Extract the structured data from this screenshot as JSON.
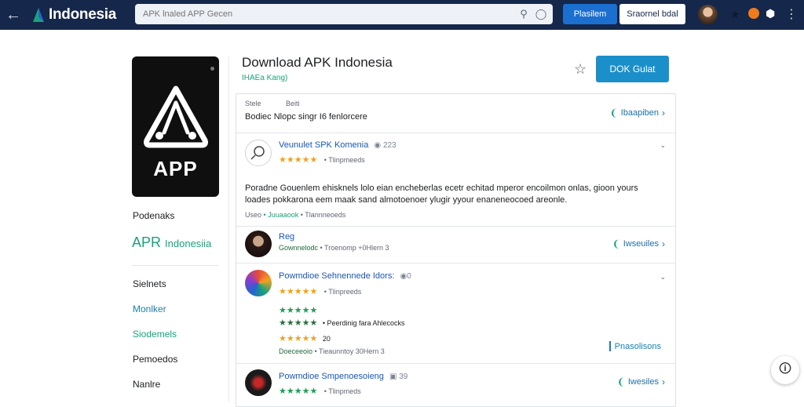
{
  "topbar": {
    "logo_text": "Indonesia",
    "search_placeholder": "APK lnaled APP Gecen",
    "primary_btn": "Plasilem",
    "outline_btn": "Sraornel bdal"
  },
  "sidebar": {
    "icon_label": "APP",
    "subtitle": "Podenaks",
    "brand_big": "APR",
    "brand_small": "Indonesiia",
    "nav": [
      "Sielnets",
      "Monlker",
      "Siodemels",
      "Pemoedos",
      "Nanlre"
    ]
  },
  "header": {
    "title": "Download APK Indonesia",
    "subtitle": "IHAEa Kang)",
    "download_btn": "DOK Gulat"
  },
  "meta": {
    "k1": "Stele",
    "k2": "Beiti",
    "value": "Bodiec  Nlopc singr  I6 fenlorcere",
    "link": "Ibaapiben"
  },
  "review1": {
    "name": "Veunulet SPK Komenia",
    "count": "223",
    "stars": "★★★★★",
    "tag": "Tlinpmeeds",
    "text": "Poradne  Gouenlem ehisknels lolo eian encheberlas ecetr echitad mperor encoilmon onlas, gioon yours loades pokkarona eem maak sand almotoenoer ylugir yyour enaneneocoed areonle.",
    "foot_a": "Useo",
    "foot_b": "Juuaaook",
    "foot_c": "Tlannneoeds"
  },
  "review2": {
    "name": "Reg",
    "meta_a": "Gownnelodc",
    "meta_b": "Troenomp +0Hlern 3",
    "link": "Iwseuiles"
  },
  "review3": {
    "name": "Powmdioe Sehnennede Idors:",
    "count": "0",
    "stars": "★★★★★",
    "tag": "Tlinpreeds",
    "line1_stars": "★★★★★",
    "line2_stars": "★★★★★",
    "line2_text": "Peerdinig fara Ahlecocks",
    "line3_stars": "★★★★★",
    "line3_num": "20",
    "meta_a": "Doeceeoio",
    "meta_b": "Tieaunntoy 30Hern 3",
    "replies": "Pnasolisons"
  },
  "review4": {
    "name": "Powmdioe Smpenoesoieng",
    "count": "39",
    "stars": "★★★★★",
    "tag": "Tlinpmeds",
    "link": "Iwesiles"
  },
  "colors": {
    "topbar": "#15274a",
    "accent_blue": "#1b8fc9",
    "accent_green": "#1aa37a",
    "star_orange": "#f0a11e"
  }
}
